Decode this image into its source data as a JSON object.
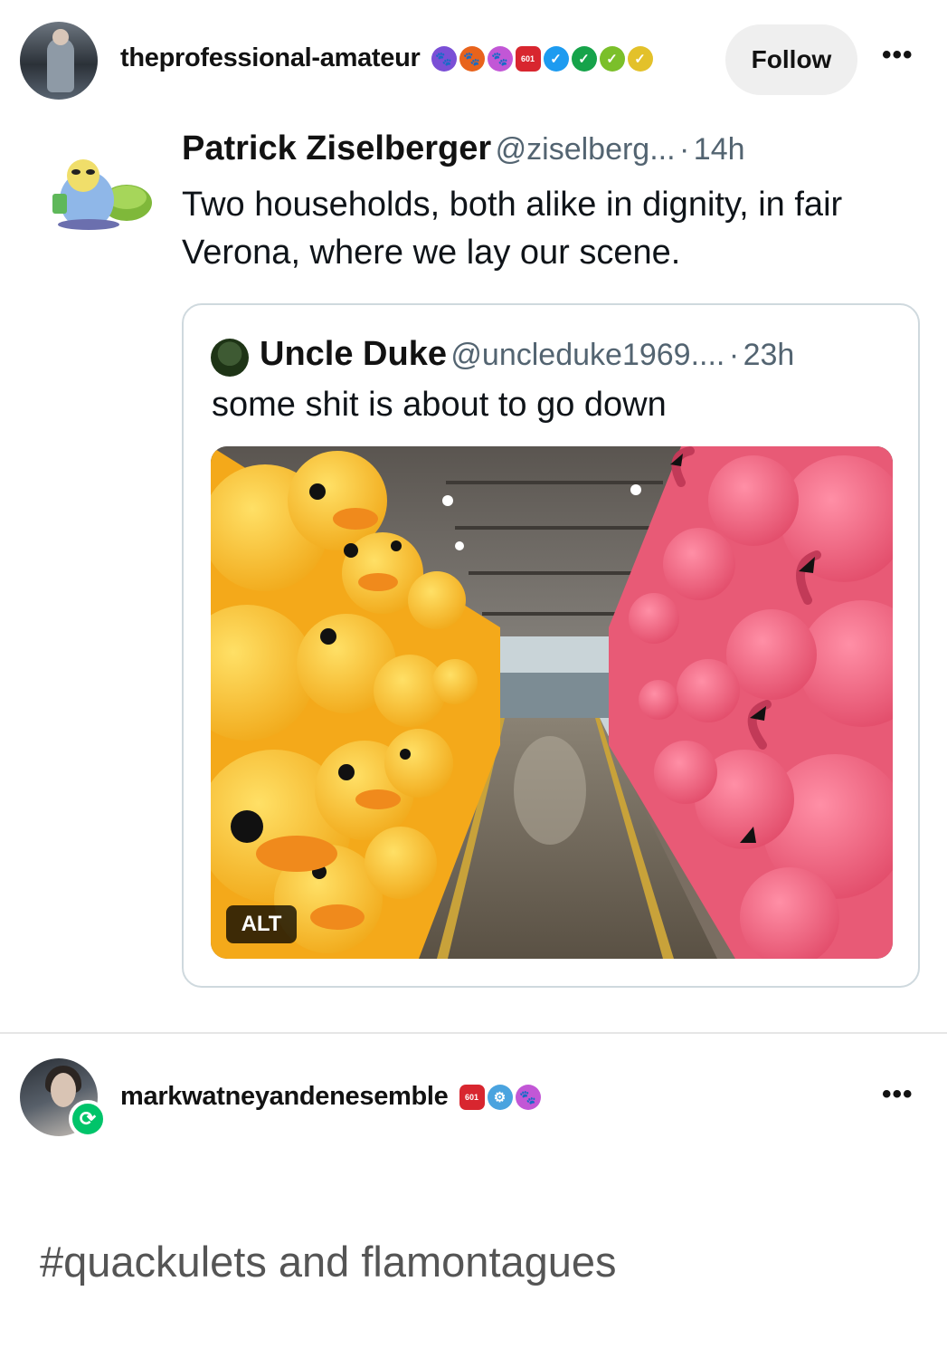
{
  "post": {
    "username": "theprofessional-amateur",
    "follow_label": "Follow",
    "more_label": "•••",
    "badges": [
      {
        "icon": "paw-badge-icon",
        "color": "#7a4fd6",
        "glyph": "🐾"
      },
      {
        "icon": "paw-badge-icon",
        "color": "#e8631c",
        "glyph": "🐾"
      },
      {
        "icon": "paw-badge-icon",
        "color": "#c257d6",
        "glyph": "🐾"
      },
      {
        "icon": "hexagon-badge-icon",
        "color": "#d8262f",
        "glyph": "601"
      },
      {
        "icon": "check-badge-icon",
        "color": "#1d9bf0",
        "glyph": "✓"
      },
      {
        "icon": "check-badge-icon",
        "color": "#16a34a",
        "glyph": "✓"
      },
      {
        "icon": "check-badge-icon",
        "color": "#7bbf2a",
        "glyph": "✓"
      },
      {
        "icon": "check-badge-icon",
        "color": "#e3c12a",
        "glyph": "✓"
      }
    ]
  },
  "tweet": {
    "name": "Patrick Ziselberger",
    "handle": "@ziselberg...",
    "separator": "·",
    "time": "14h",
    "text": "Two households, both alike in dignity, in fair Verona, where we lay our scene."
  },
  "quote": {
    "name": "Uncle Duke",
    "handle": "@uncleduke1969....",
    "separator": "·",
    "time": "23h",
    "text": "some shit is about to go down",
    "alt_label": "ALT"
  },
  "reblog": {
    "username": "markwatneyandenesemble",
    "more_label": "•••",
    "badges": [
      {
        "icon": "hexagon-badge-icon",
        "color": "#d8262f",
        "glyph": "601"
      },
      {
        "icon": "robot-badge-icon",
        "color": "#4aa3df",
        "glyph": "⚙"
      },
      {
        "icon": "paw-badge-icon",
        "color": "#c257d6",
        "glyph": "🐾"
      }
    ],
    "tag": "#quackulets and flamontagues"
  },
  "colors": {
    "follow_bg": "#efefef",
    "reblog_green": "#00c46a",
    "duck_yellow": "#f5b51b",
    "flamingo_pink": "#f0637e"
  }
}
